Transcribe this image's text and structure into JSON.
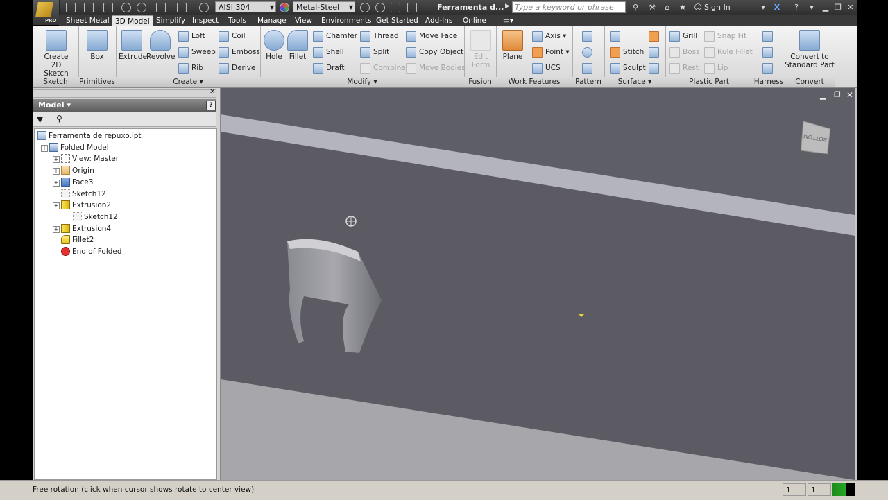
{
  "titlebar": {
    "material": "AISI 304",
    "appearance": "Metal-Steel",
    "doc_title": "Ferramenta d...",
    "search_placeholder": "Type a keyword or phrase",
    "sign_in": "Sign In",
    "app_badge": "PRO"
  },
  "tabs": [
    "Sheet Metal",
    "3D Model",
    "Simplify",
    "Inspect",
    "Tools",
    "Manage",
    "View",
    "Environments",
    "Get Started",
    "Add-Ins",
    "Online"
  ],
  "active_tab": "3D Model",
  "ribbon": {
    "sketch": {
      "label": "Sketch",
      "create_sketch_line1": "Create",
      "create_sketch_line2": "2D Sketch"
    },
    "primitives": {
      "label": "Primitives",
      "box": "Box"
    },
    "create": {
      "label": "Create",
      "extrude": "Extrude",
      "revolve": "Revolve",
      "loft": "Loft",
      "sweep": "Sweep",
      "rib": "Rib",
      "coil": "Coil",
      "emboss": "Emboss",
      "derive": "Derive"
    },
    "modify": {
      "label": "Modify",
      "hole": "Hole",
      "fillet": "Fillet",
      "chamfer": "Chamfer",
      "shell": "Shell",
      "draft": "Draft",
      "thread": "Thread",
      "split": "Split",
      "combine": "Combine",
      "move_face": "Move Face",
      "copy_object": "Copy Object",
      "move_bodies": "Move Bodies"
    },
    "fusion": {
      "label": "Fusion",
      "edit_form_line1": "Edit",
      "edit_form_line2": "Form"
    },
    "work_features": {
      "label": "Work Features",
      "plane": "Plane",
      "axis": "Axis",
      "point": "Point",
      "ucs": "UCS"
    },
    "pattern": {
      "label": "Pattern"
    },
    "surface": {
      "label": "Surface",
      "stitch": "Stitch",
      "sculpt": "Sculpt"
    },
    "plastic_part": {
      "label": "Plastic Part",
      "grill": "Grill",
      "boss": "Boss",
      "rest": "Rest",
      "snap_fit": "Snap Fit",
      "rule_fillet": "Rule Fillet",
      "lip": "Lip"
    },
    "harness": {
      "label": "Harness"
    },
    "convert": {
      "label": "Convert",
      "convert_line1": "Convert to",
      "convert_line2": "Standard Part"
    }
  },
  "browser": {
    "title": "Model",
    "help": "?",
    "tree": [
      {
        "label": "Ferramenta de repuxo.ipt",
        "icon": "part-icon",
        "level": 0,
        "expander": false
      },
      {
        "label": "Folded Model",
        "icon": "folded-model-icon",
        "level": 1,
        "expander": true
      },
      {
        "label": "View: Master",
        "icon": "view-icon",
        "level": 2,
        "expander": true
      },
      {
        "label": "Origin",
        "icon": "folder-icon",
        "level": 2,
        "expander": true
      },
      {
        "label": "Face3",
        "icon": "face-icon",
        "level": 2,
        "expander": true
      },
      {
        "label": "Sketch12",
        "icon": "sketch-icon",
        "level": 2,
        "expander": false
      },
      {
        "label": "Extrusion2",
        "icon": "extrusion-icon",
        "level": 2,
        "expander": true
      },
      {
        "label": "Sketch12",
        "icon": "sketch-icon",
        "level": 3,
        "expander": false
      },
      {
        "label": "Extrusion4",
        "icon": "extrusion-icon",
        "level": 2,
        "expander": true
      },
      {
        "label": "Fillet2",
        "icon": "fillet-icon",
        "level": 2,
        "expander": false
      },
      {
        "label": "End of Folded",
        "icon": "end-of-part-icon",
        "level": 2,
        "expander": false
      }
    ]
  },
  "viewcube": {
    "face": "BOTTOM"
  },
  "status": {
    "message": "Free rotation (click when cursor shows rotate to center view)",
    "field1": "1",
    "field2": "1"
  },
  "colors": {
    "ribbon_bg": "#e4e4e4",
    "viewport": "#5e5e66",
    "tab_bar": "#3a3a3a"
  }
}
